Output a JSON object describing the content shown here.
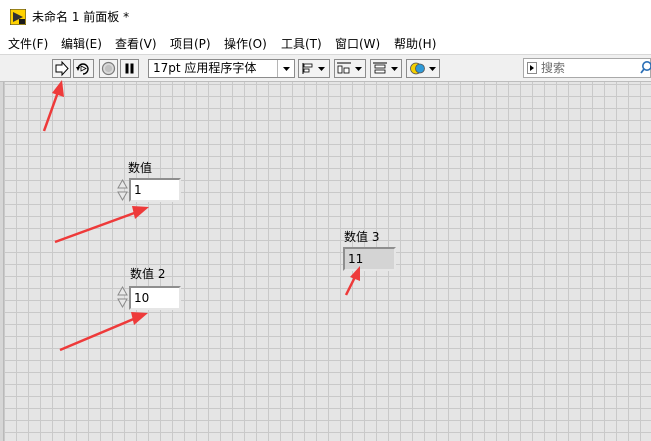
{
  "window": {
    "title": "未命名 1 前面板 *"
  },
  "menu": [
    {
      "id": "file",
      "label": "文件(F)"
    },
    {
      "id": "edit",
      "label": "编辑(E)"
    },
    {
      "id": "view",
      "label": "查看(V)"
    },
    {
      "id": "project",
      "label": "项目(P)"
    },
    {
      "id": "operate",
      "label": "操作(O)"
    },
    {
      "id": "tools",
      "label": "工具(T)"
    },
    {
      "id": "window",
      "label": "窗口(W)"
    },
    {
      "id": "help",
      "label": "帮助(H)"
    }
  ],
  "toolbar": {
    "font": "17pt 应用程序字体",
    "search_placeholder": "搜索",
    "buttons": [
      "run-arrow-icon",
      "run-continuously-icon",
      "abort-icon",
      "pause-icon",
      "align-icon",
      "distribute-icon",
      "resize-icon",
      "reorder-icon"
    ]
  },
  "controls": [
    {
      "id": "numeric1",
      "label": "数值",
      "value": "1",
      "kind": "control"
    },
    {
      "id": "numeric2",
      "label": "数值 2",
      "value": "10",
      "kind": "control"
    },
    {
      "id": "numeric3",
      "label": "数值 3",
      "value": "11",
      "kind": "indicator"
    }
  ],
  "colors": {
    "canvas": "#e5e5e5",
    "grid": "#c9c9c9",
    "annotation_arrow": "#ee3a3a"
  }
}
